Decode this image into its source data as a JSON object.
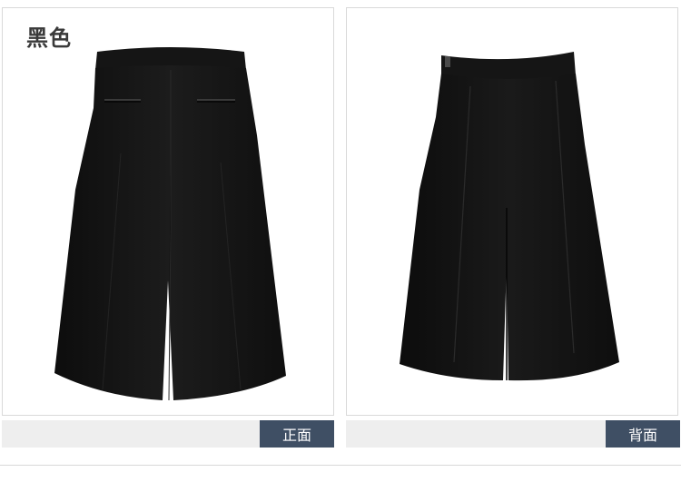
{
  "color_label": "黑色",
  "views": {
    "front_label": "正面",
    "back_label": "背面"
  },
  "colors": {
    "garment": "#141414",
    "label_background": "#3f4f64",
    "bar_background": "#eeeeee",
    "panel_border": "#d9d9d9"
  },
  "images": {
    "front": "black-wide-leg-culottes-front",
    "back": "black-wide-leg-culottes-back"
  }
}
